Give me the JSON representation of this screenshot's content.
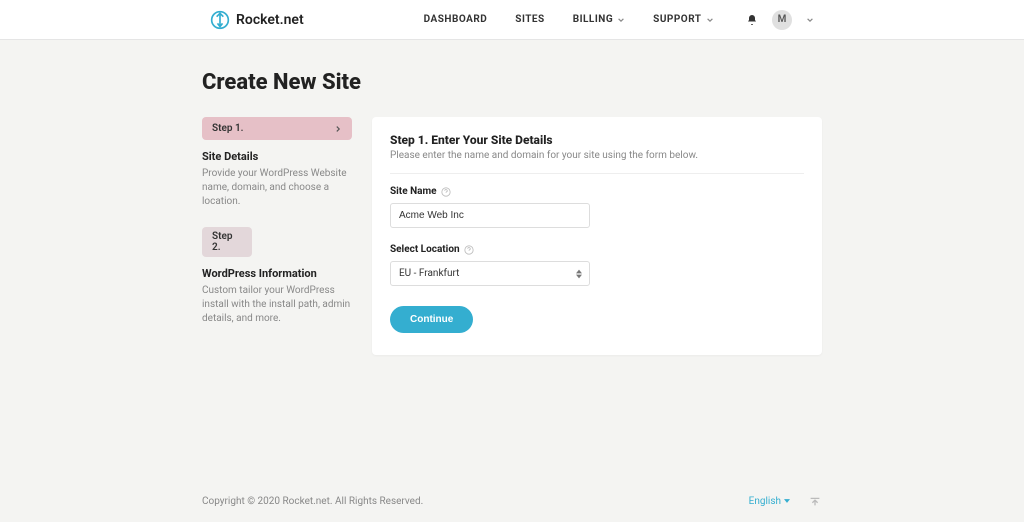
{
  "brand": {
    "name": "Rocket.net"
  },
  "nav": {
    "dashboard": "DASHBOARD",
    "sites": "SITES",
    "billing": "BILLING",
    "support": "SUPPORT"
  },
  "avatar_initial": "M",
  "page_title": "Create New Site",
  "steps": [
    {
      "pill": "Step 1.",
      "title": "Site Details",
      "desc": "Provide your WordPress Website name, domain, and choose a location."
    },
    {
      "pill": "Step 2.",
      "title": "WordPress Information",
      "desc": "Custom tailor your WordPress install with the install path, admin details, and more."
    }
  ],
  "card": {
    "title": "Step 1. Enter Your Site Details",
    "subtitle": "Please enter the name and domain for your site using the form below.",
    "site_name_label": "Site Name",
    "site_name_value": "Acme Web Inc",
    "location_label": "Select Location",
    "location_value": "EU - Frankfurt",
    "continue_label": "Continue"
  },
  "footer": {
    "copyright": "Copyright © 2020 Rocket.net. All Rights Reserved.",
    "language": "English"
  },
  "colors": {
    "accent": "#34aed0",
    "pill_active": "#e6c0c7",
    "pill_inactive": "#e3d7da"
  }
}
